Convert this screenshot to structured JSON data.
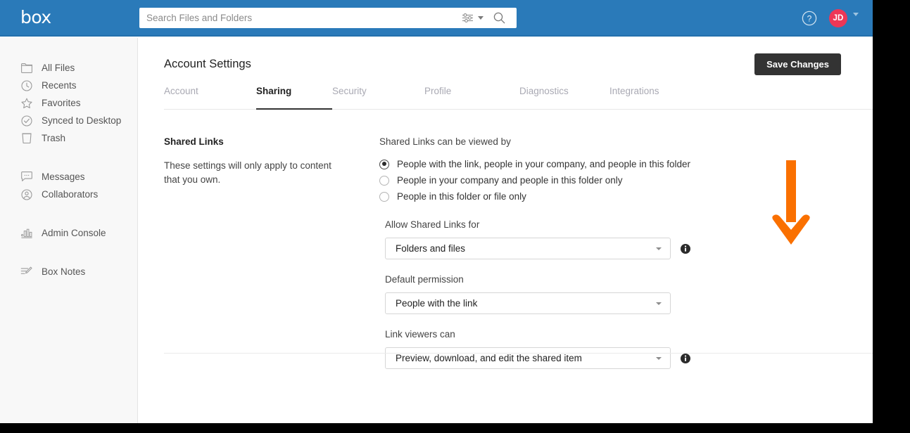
{
  "header": {
    "logo_text": "box",
    "search": {
      "placeholder": "Search Files and Folders",
      "value": "",
      "filter_icon": "filter-sliders-icon",
      "caret_icon": "chevron-down-icon",
      "search_icon": "magnifier-icon"
    },
    "help_icon": "help-circle-icon",
    "avatar_initials": "JD",
    "avatar_caret_icon": "chevron-down-icon",
    "colors": {
      "header_bg": "#2A7AB9",
      "avatar_bg": "#ED3757"
    }
  },
  "sidebar": {
    "items": [
      {
        "label": "All Files",
        "icon": "folder-icon"
      },
      {
        "label": "Recents",
        "icon": "clock-icon"
      },
      {
        "label": "Favorites",
        "icon": "star-icon"
      },
      {
        "label": "Synced to Desktop",
        "icon": "check-circle-icon"
      },
      {
        "label": "Trash",
        "icon": "trash-icon"
      },
      {
        "label": "Messages",
        "icon": "chat-bubble-icon"
      },
      {
        "label": "Collaborators",
        "icon": "user-circle-icon"
      },
      {
        "label": "Admin Console",
        "icon": "bar-chart-icon"
      },
      {
        "label": "Box Notes",
        "icon": "notes-icon"
      }
    ]
  },
  "main": {
    "page_title": "Account Settings",
    "save_button": "Save Changes",
    "tabs": [
      {
        "label": "Account",
        "active": false
      },
      {
        "label": "Sharing",
        "active": true
      },
      {
        "label": "Security",
        "active": false
      },
      {
        "label": "Profile",
        "active": false
      },
      {
        "label": "Diagnostics",
        "active": false
      },
      {
        "label": "Integrations",
        "active": false
      }
    ],
    "section": {
      "title": "Shared Links",
      "description": "These settings will only apply to content that you own."
    },
    "radio_group": {
      "label": "Shared Links can be viewed by",
      "options": [
        {
          "label": "People with the link, people in your company, and people in this folder",
          "selected": true
        },
        {
          "label": "People in your company and people in this folder only",
          "selected": false
        },
        {
          "label": "People in this folder or file only",
          "selected": false
        }
      ]
    },
    "fields": [
      {
        "label": "Allow Shared Links for",
        "value": "Folders and files",
        "has_info": true,
        "info_icon": "info-icon",
        "caret_icon": "chevron-down-icon"
      },
      {
        "label": "Default permission",
        "value": "People with the link",
        "has_info": false,
        "info_icon": "",
        "caret_icon": "chevron-down-icon"
      },
      {
        "label": "Link viewers can",
        "value": "Preview, download, and edit the shared item",
        "has_info": true,
        "info_icon": "info-icon",
        "caret_icon": "chevron-down-icon"
      }
    ]
  },
  "annotation": {
    "icon": "down-arrow-annotation",
    "color": "#FA7000",
    "direction": "down"
  }
}
